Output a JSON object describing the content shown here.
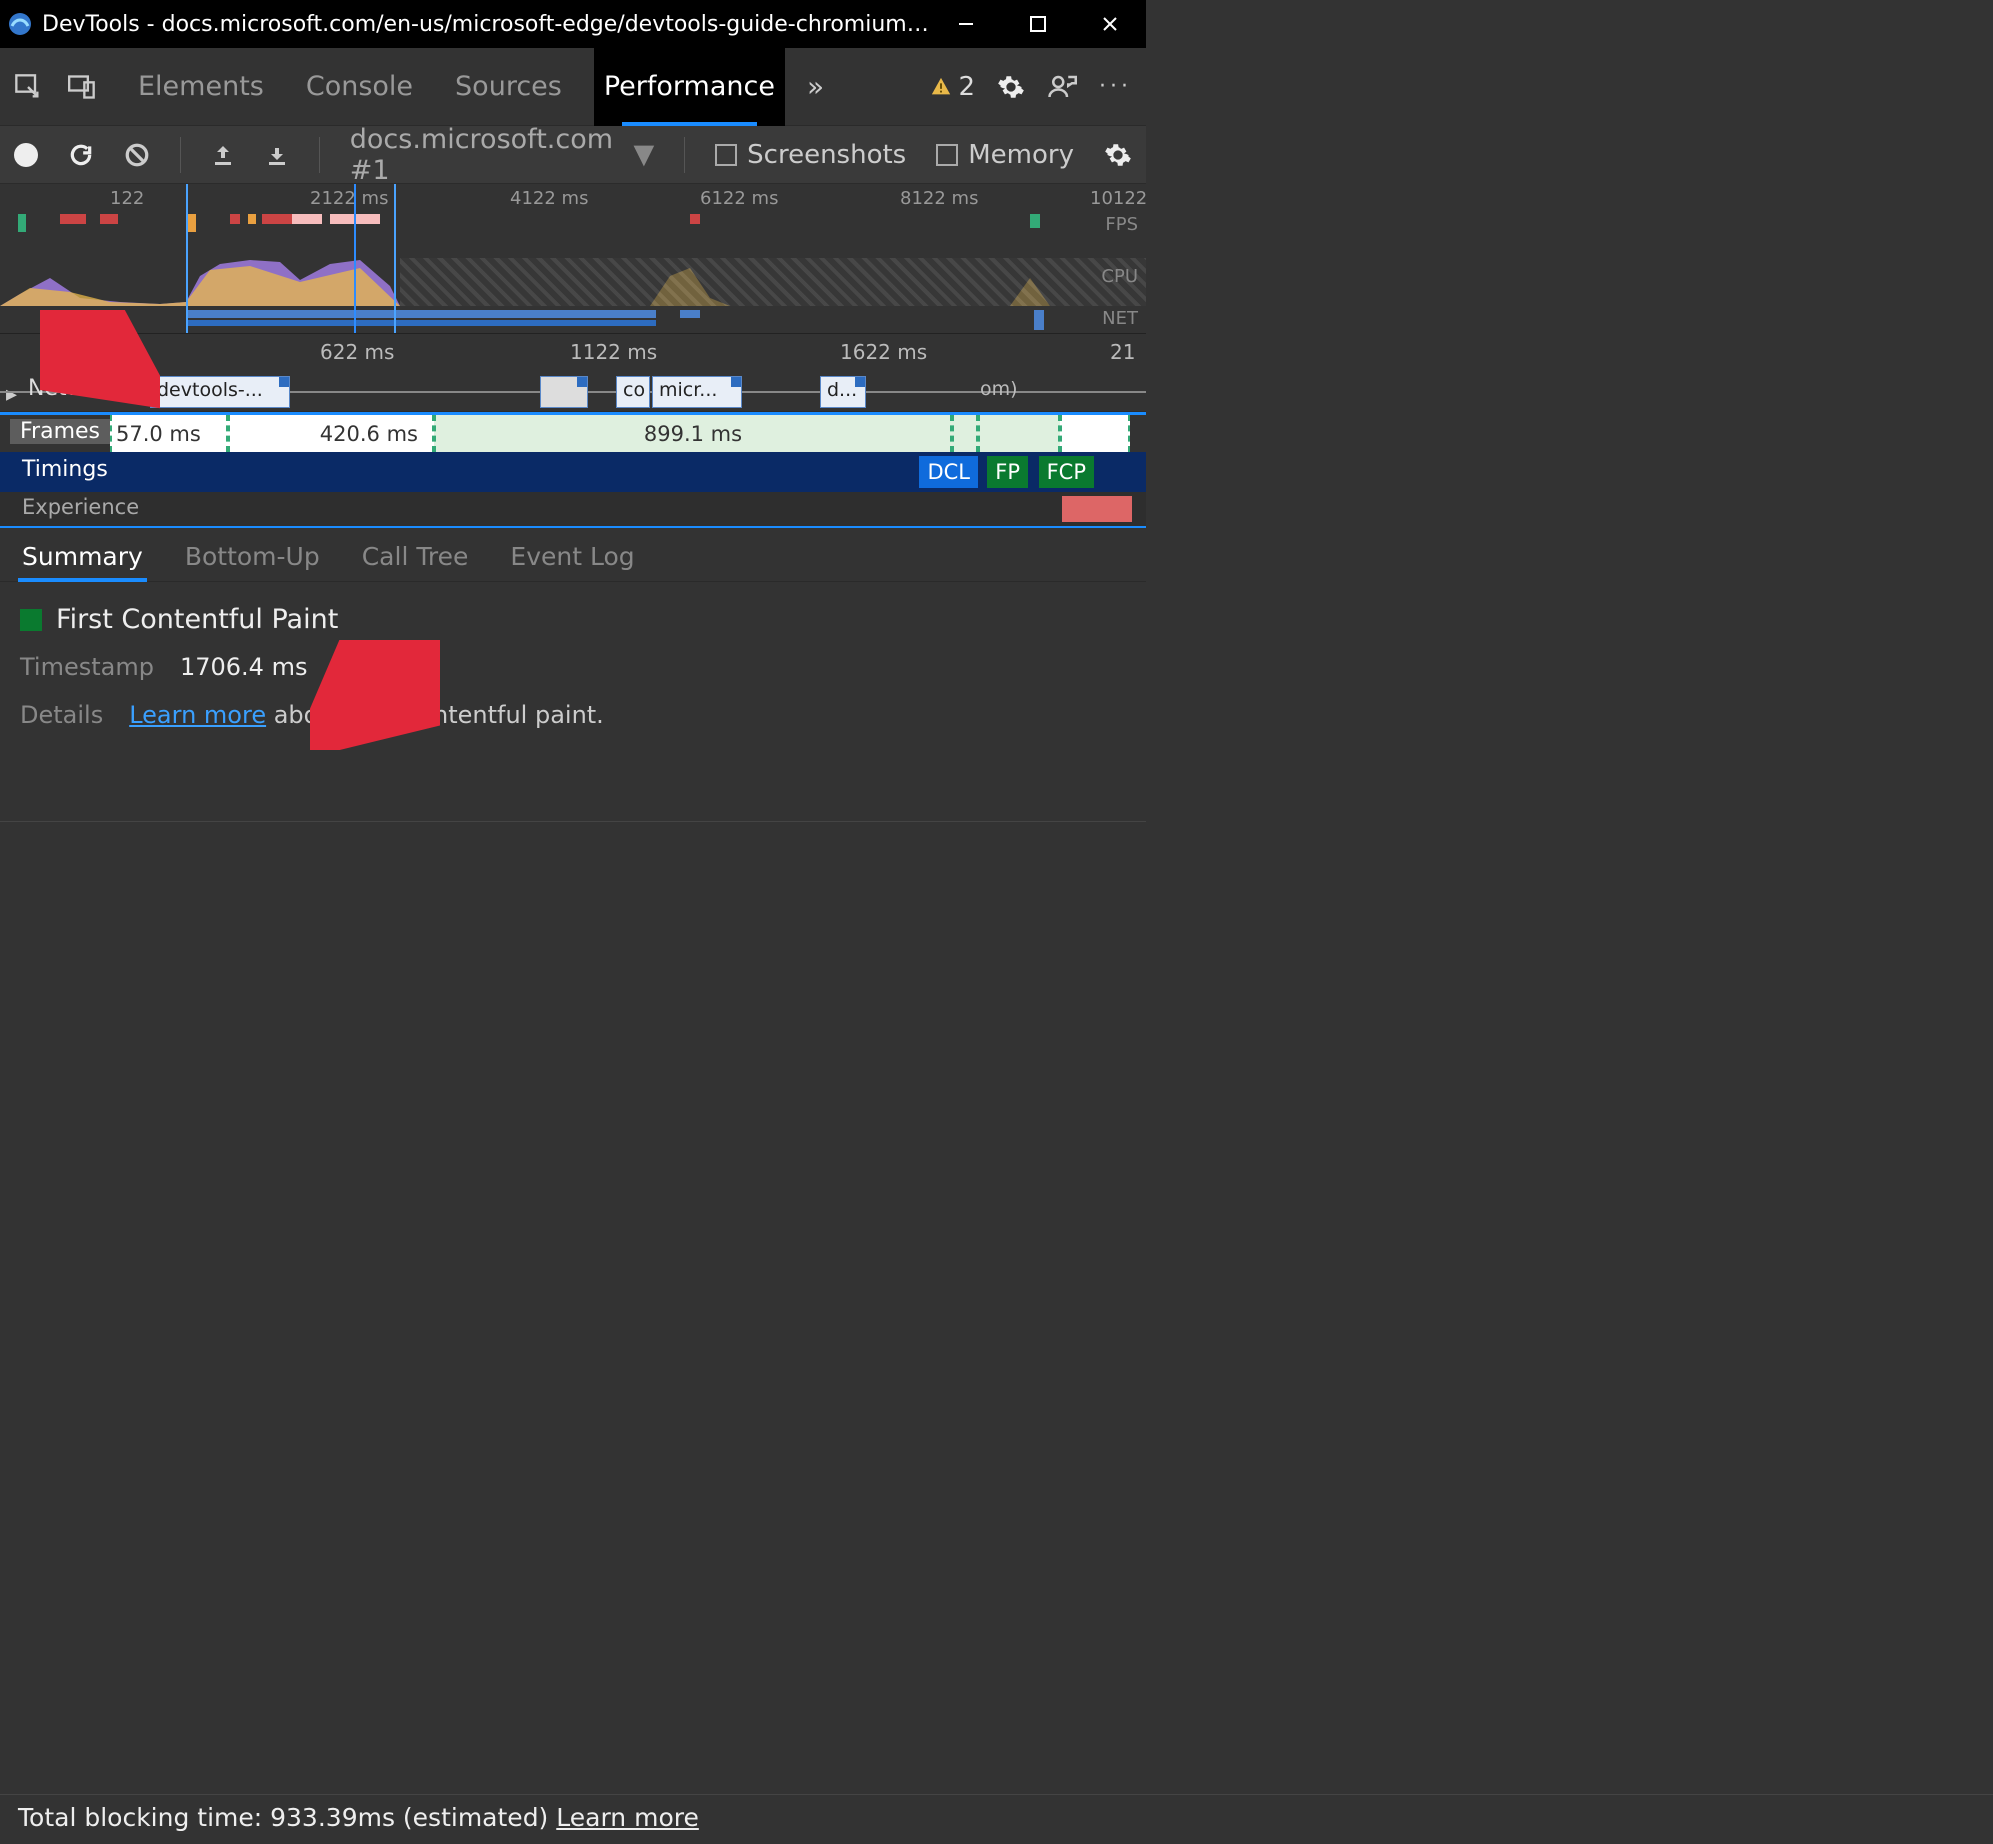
{
  "window": {
    "title": "DevTools - docs.microsoft.com/en-us/microsoft-edge/devtools-guide-chromium - [InPri..."
  },
  "tabs": {
    "elements": "Elements",
    "console": "Console",
    "sources": "Sources",
    "performance": "Performance",
    "warning_count": "2"
  },
  "toolbar": {
    "target": "docs.microsoft.com #1",
    "screenshots_label": "Screenshots",
    "memory_label": "Memory"
  },
  "overview": {
    "ticks": [
      "122",
      "2122 ms",
      "4122 ms",
      "6122 ms",
      "8122 ms",
      "10122"
    ],
    "fps_label": "FPS",
    "cpu_label": "CPU",
    "net_label": "NET"
  },
  "flame": {
    "ticks": [
      "122",
      "622 ms",
      "1122 ms",
      "1622 ms",
      "21"
    ],
    "network_label": "Network",
    "network_blocks": [
      "devtools-...",
      "co",
      "micr...",
      "d...",
      "om)"
    ],
    "frames_label": "Frames",
    "frames": [
      "57.0 ms",
      "420.6 ms",
      "899.1 ms"
    ],
    "timings_label": "Timings",
    "timings_badges": {
      "dcl": "DCL",
      "fp": "FP",
      "fcp": "FCP"
    },
    "experience_label": "Experience"
  },
  "bottom_tabs": {
    "summary": "Summary",
    "bottom_up": "Bottom-Up",
    "call_tree": "Call Tree",
    "event_log": "Event Log"
  },
  "summary": {
    "title": "First Contentful Paint",
    "timestamp_label": "Timestamp",
    "timestamp_value": "1706.4 ms",
    "details_label": "Details",
    "learn_more": "Learn more",
    "details_suffix": " about first contentful paint."
  },
  "footer": {
    "tbt_prefix": "Total blocking time: ",
    "tbt_value": "933.39ms (estimated) ",
    "learn_more": "Learn more"
  }
}
